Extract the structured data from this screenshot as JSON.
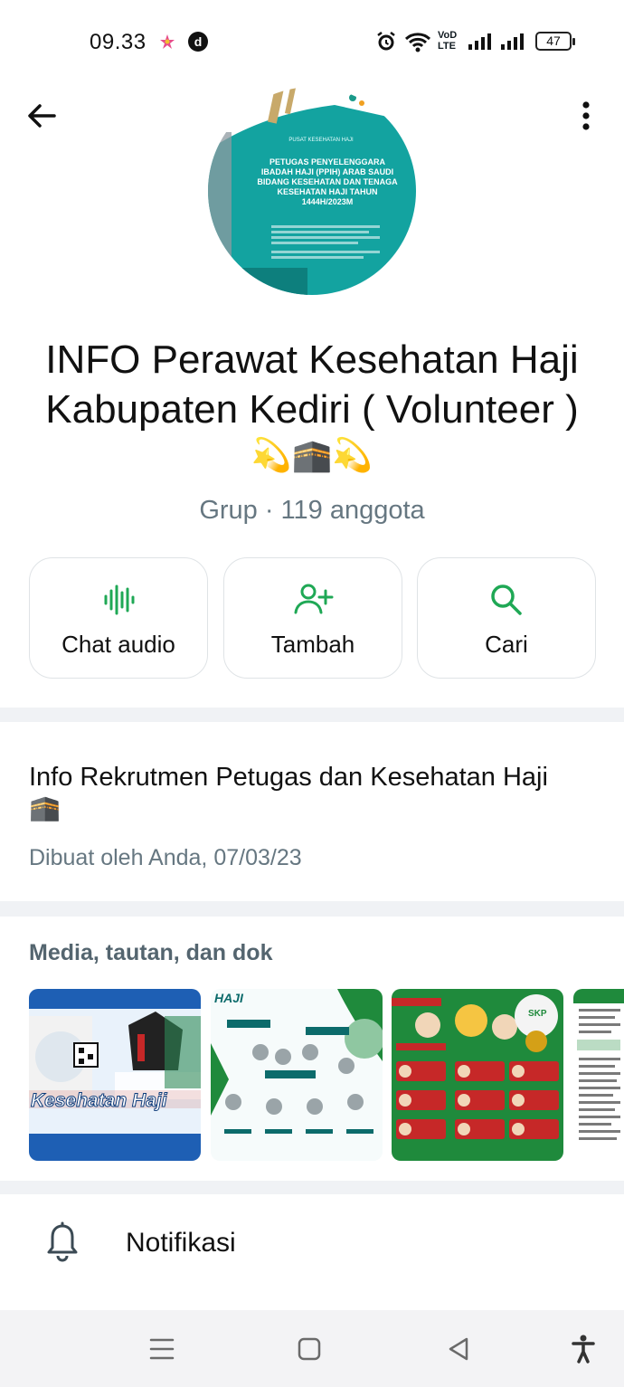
{
  "status_bar": {
    "time": "09.33",
    "network_label": "VoD LTE",
    "battery": "47"
  },
  "group": {
    "title": "INFO Perawat Kesehatan Haji Kabupaten Kediri ( Volunteer )",
    "title_emoji": "💫🕋💫",
    "subtitle": "Grup · 119 anggota"
  },
  "avatar": {
    "header_small": "PUSAT KESEHATAN HAJI",
    "headline": "PETUGAS PENYELENGGARA IBADAH HAJI (PPIH) ARAB SAUDI BIDANG KESEHATAN DAN TENAGA KESEHATAN HAJI TAHUN 1444H/2023M"
  },
  "actions": [
    {
      "label": "Chat audio",
      "icon": "audio-wave-icon"
    },
    {
      "label": "Tambah",
      "icon": "add-person-icon"
    },
    {
      "label": "Cari",
      "icon": "search-icon"
    }
  ],
  "description": {
    "text": "Info Rekrutmen Petugas dan Kesehatan Haji",
    "emoji": "🕋",
    "meta": "Dibuat oleh Anda, 07/03/23"
  },
  "media": {
    "heading": "Media, tautan, dan dok",
    "thumbs": [
      {
        "caption": "Kesehatan Haji"
      },
      {
        "caption": "HAJI"
      },
      {
        "caption": "SKP"
      },
      {
        "caption": ""
      }
    ]
  },
  "notification": {
    "label": "Notifikasi"
  },
  "colors": {
    "accent": "#1fa855",
    "avatar_teal": "#13a3a0",
    "media_green": "#1f8a3c"
  }
}
